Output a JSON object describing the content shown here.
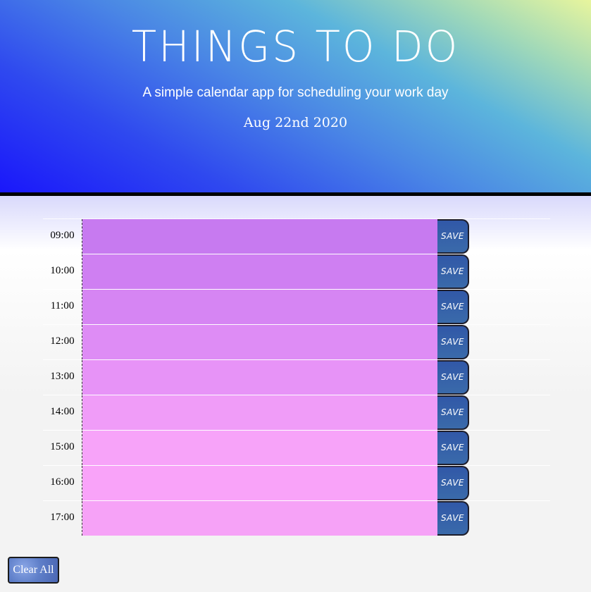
{
  "header": {
    "title": "THINGS TO DO",
    "subtitle": "A simple calendar app for scheduling your work day",
    "date": "Aug 22nd 2020"
  },
  "schedule": {
    "save_label": "SAVE",
    "rows": [
      {
        "hour": "09:00",
        "task": "",
        "color": "#c77af0"
      },
      {
        "hour": "10:00",
        "task": "",
        "color": "#cf7ff2"
      },
      {
        "hour": "11:00",
        "task": "",
        "color": "#d685f3"
      },
      {
        "hour": "12:00",
        "task": "",
        "color": "#de8cf5"
      },
      {
        "hour": "13:00",
        "task": "",
        "color": "#e793f7"
      },
      {
        "hour": "14:00",
        "task": "",
        "color": "#f09cf8"
      },
      {
        "hour": "15:00",
        "task": "",
        "color": "#f7a3f9"
      },
      {
        "hour": "16:00",
        "task": "",
        "color": "#f9a3f9"
      },
      {
        "hour": "17:00",
        "task": "",
        "color": "#f6a2f7"
      }
    ]
  },
  "footer": {
    "clear_label": "Clear All"
  },
  "colors": {
    "header_start": "#1a17fb",
    "header_end": "#e8f59d",
    "save_button": "#3158a8"
  }
}
